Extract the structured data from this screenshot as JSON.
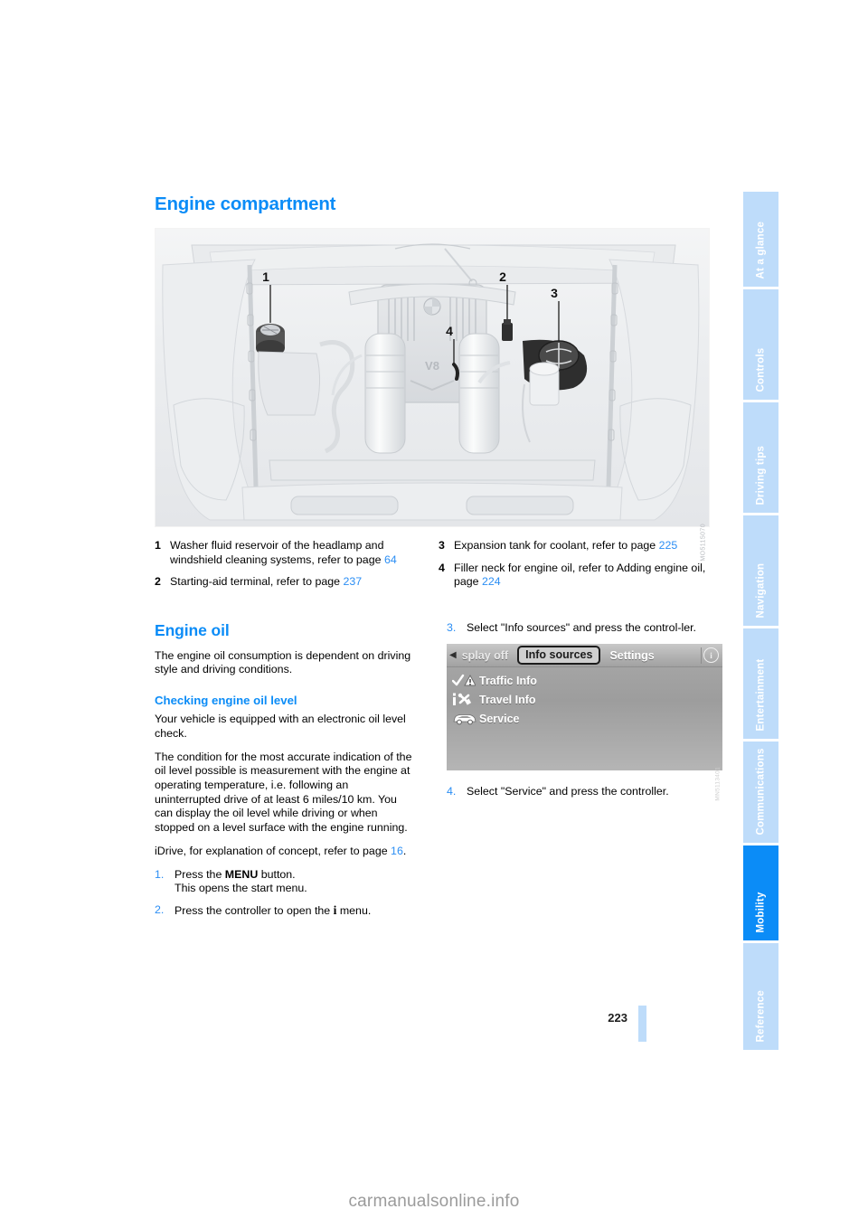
{
  "document": {
    "page_number": "223",
    "watermark": "carmanualsonline.info"
  },
  "sidebar": {
    "tabs": [
      {
        "label": "At a glance",
        "active": false
      },
      {
        "label": "Controls",
        "active": false
      },
      {
        "label": "Driving tips",
        "active": false
      },
      {
        "label": "Navigation",
        "active": false
      },
      {
        "label": "Entertainment",
        "active": false
      },
      {
        "label": "Communications",
        "active": false
      },
      {
        "label": "Mobility",
        "active": true
      },
      {
        "label": "Reference",
        "active": false
      }
    ],
    "active_color": "#0b8cf7",
    "inactive_color": "#bedcfa"
  },
  "engine_compartment": {
    "title": "Engine compartment",
    "figure": {
      "ref_code": "MO5115070",
      "callouts": [
        "1",
        "2",
        "3",
        "4"
      ]
    },
    "legend": [
      {
        "num": "1",
        "text_before": "Washer fluid reservoir of the headlamp and windshield cleaning systems, refer to page ",
        "ref": "64",
        "text_after": ""
      },
      {
        "num": "2",
        "text_before": "Starting-aid terminal, refer to page ",
        "ref": "237",
        "text_after": ""
      },
      {
        "num": "3",
        "text_before": "Expansion tank for coolant, refer to page ",
        "ref": "225",
        "text_after": ""
      },
      {
        "num": "4",
        "text_before": "Filler neck for engine oil, refer to Adding engine oil, page ",
        "ref": "224",
        "text_after": ""
      }
    ]
  },
  "engine_oil": {
    "title": "Engine oil",
    "intro": "The engine oil consumption is dependent on driving style and driving conditions.",
    "checking": {
      "title": "Checking engine oil level",
      "para1": "Your vehicle is equipped with an electronic oil level check.",
      "para2": "The condition for the most accurate indication of the oil level possible is measurement with the engine at operating temperature, i.e. following an uninterrupted drive of at least 6 miles/10 km. You can display the oil level while driving or when stopped on a level surface with the engine running.",
      "idrive_note_before": "iDrive, for explanation of concept, refer to page ",
      "idrive_note_ref": "16",
      "idrive_note_after": "."
    },
    "steps": [
      {
        "num": "1.",
        "line1_a": "Press the ",
        "line1_kbd": "MENU",
        "line1_b": " button.",
        "line2": "This opens the start menu."
      },
      {
        "num": "2.",
        "line1_a": "Press the controller to open the ",
        "line1_kbd": "i",
        "line1_b": " menu."
      },
      {
        "num": "3.",
        "line1_a": "Select \"Info sources\" and press the control-ler.",
        "line1_kbd": "",
        "line1_b": ""
      },
      {
        "num": "4.",
        "line1_a": "Select \"Service\" and press the controller.",
        "line1_kbd": "",
        "line1_b": ""
      }
    ]
  },
  "idrive_screen": {
    "ref_code": "MN5113401",
    "topbar": {
      "back_icon": "left-triangle-icon",
      "item_truncated": "splay off",
      "item_selected": "Info sources",
      "item_settings": "Settings",
      "info_badge": "i"
    },
    "menu_items": [
      {
        "icon": "traffic-warning-icon",
        "label": "Traffic Info"
      },
      {
        "icon": "travel-info-icon",
        "label": "Travel Info"
      },
      {
        "icon": "car-service-icon",
        "label": "Service"
      }
    ]
  }
}
